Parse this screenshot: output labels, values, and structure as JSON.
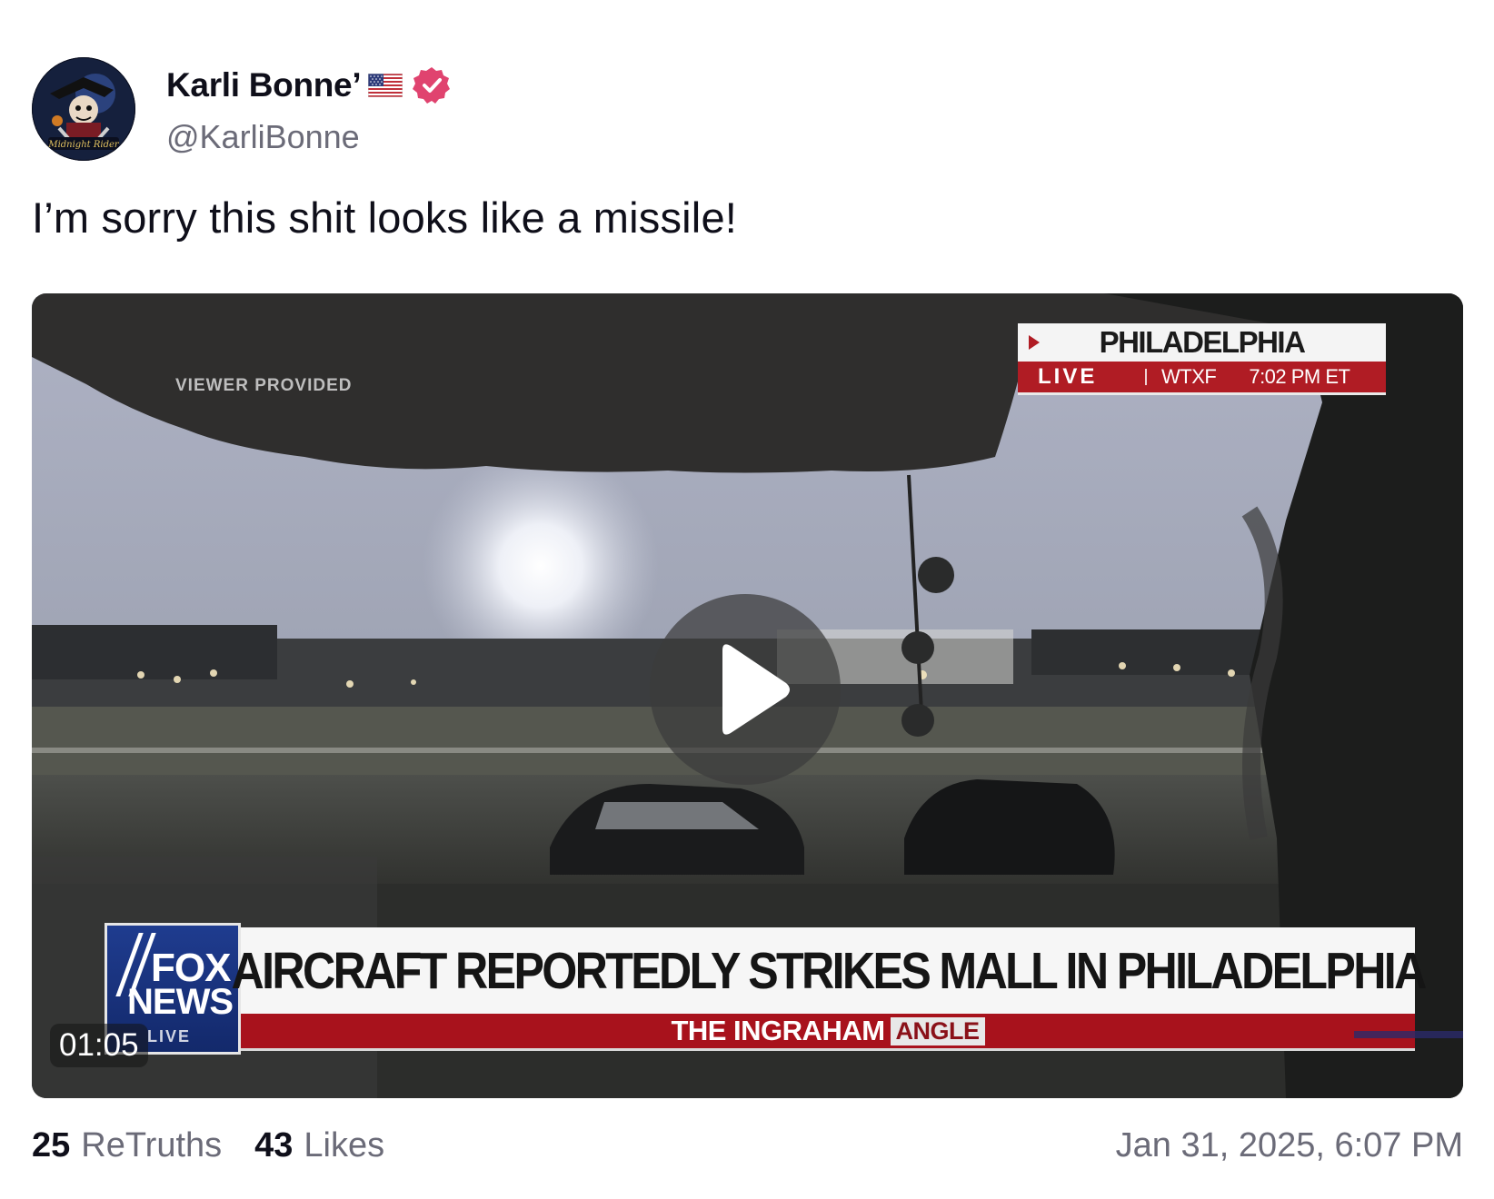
{
  "author": {
    "display_name": "Karli Bonne’",
    "handle": "@KarliBonne",
    "avatar_text": "Midnight Rider",
    "flag_icon": "us-flag-icon",
    "verified_icon": "verified-badge-icon",
    "verified_color": "#e0436f"
  },
  "post": {
    "text": "I’m sorry this shit looks like a missile!"
  },
  "video": {
    "duration": "01:05",
    "overlay": {
      "viewer_provided": "VIEWER PROVIDED",
      "location": "PHILADELPHIA",
      "live_label": "LIVE",
      "station": "WTXF",
      "time": "7:02 PM ET",
      "network_logo_top": "FOX",
      "network_logo_bottom": "NEWS",
      "logo_live_tag": "LIVE",
      "headline": "AIRCRAFT REPORTEDLY STRIKES MALL IN PHILADELPHIA",
      "show_name": "THE INGRAHAM",
      "show_name_suffix": "ANGLE"
    },
    "play_icon": "play-icon"
  },
  "stats": {
    "retruths_count": "25",
    "retruths_label": "ReTruths",
    "likes_count": "43",
    "likes_label": "Likes",
    "timestamp": "Jan 31, 2025, 6:07 PM"
  },
  "colors": {
    "text_primary": "#0f0f1a",
    "text_secondary": "#6b6b78",
    "fox_red": "#a8121c",
    "fox_blue": "#1f3c8f"
  }
}
